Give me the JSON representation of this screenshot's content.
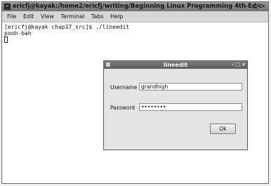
{
  "terminal": {
    "title": "ericfj@kayak:/home2/ericfj/writing/Beginning Linux Programming 4th Ed/c",
    "window_buttons": [
      "–",
      "□",
      "×"
    ],
    "menu": [
      "File",
      "Edit",
      "View",
      "Terminal",
      "Tabs",
      "Help"
    ],
    "lines": [
      "[ericfj@kayak chap17_src]$ ./lineedit",
      "pooh-bah"
    ]
  },
  "dialog": {
    "title": "lineedit",
    "window_buttons": [
      "–",
      "□",
      "×"
    ],
    "username_label": "Username",
    "username_value": "grandhigh",
    "password_label": "Password",
    "password_value": "••••••••",
    "ok_label": "Ok"
  }
}
